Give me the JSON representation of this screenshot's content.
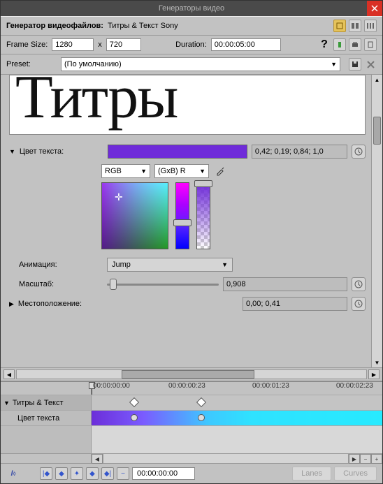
{
  "title": "Генераторы видео",
  "header": {
    "gen_label": "Генератор видеофайлов:",
    "gen_value": "Титры & Текст Sony",
    "frame_size_label": "Frame Size:",
    "width": "1280",
    "x": "x",
    "height": "720",
    "duration_label": "Duration:",
    "duration": "00:00:05:00",
    "preset_label": "Preset:",
    "preset_value": "(По умолчанию)"
  },
  "title_preview": "Титры",
  "properties": {
    "text_color_label": "Цвет текста:",
    "text_color_hex": "#6f2bd9",
    "text_color_value": "0,42; 0,19; 0,84; 1,0",
    "mode1": "RGB",
    "mode2": "(GxB) R",
    "animation_label": "Анимация:",
    "animation_value": "Jump",
    "scale_label": "Масштаб:",
    "scale_value": "0,908",
    "position_label": "Местоположение:",
    "position_value": "0,00; 0,41"
  },
  "timeline": {
    "ticks": [
      "00:00:00:00",
      "00:00:00:23",
      "00:00:01:23",
      "00:00:02:23"
    ],
    "track1_label": "Титры & Текст",
    "track2_label": "Цвет текста"
  },
  "bottom": {
    "timecode": "00:00:00:00",
    "lanes": "Lanes",
    "curves": "Curves"
  }
}
